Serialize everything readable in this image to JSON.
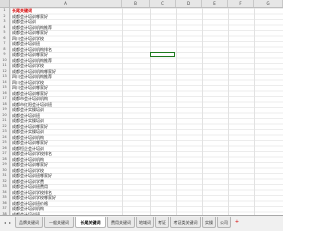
{
  "columns": [
    "A",
    "B",
    "C",
    "D",
    "E",
    "F",
    "G"
  ],
  "rows": [
    "1",
    "2",
    "3",
    "4",
    "5",
    "6",
    "7",
    "8",
    "9",
    "10",
    "11",
    "12",
    "13",
    "14",
    "15",
    "16",
    "17",
    "18",
    "19",
    "20",
    "21",
    "22",
    "23",
    "24",
    "25",
    "26",
    "27",
    "28",
    "29",
    "30",
    "31",
    "32",
    "33",
    "34",
    "35",
    "36",
    "37",
    "38",
    "39",
    "40"
  ],
  "cells": [
    "长尾关键词",
    "成都会计培训哪家好",
    "成都会计培训",
    "成都会计培训机构推荐",
    "成都会计培训哪家好",
    "四川会计培训学校",
    "成都会计培训班",
    "成都会计培训机构排名",
    "成都会计培训哪家好",
    "成都会计培训机构推荐",
    "成都会计培训学校",
    "成都会计培训机构哪家好",
    "四川会计培训机构推荐",
    "四川会计培训学校",
    "四川会计培训哪家好",
    "成都会计培训哪家好",
    "成都市会计培训机构",
    "成都市红阳会计培训班",
    "成都会计实操培训",
    "成都会计培训班",
    "成都会计实操培训",
    "成都会计培训哪家好",
    "成都会计实操培训",
    "成都会计培训机构",
    "成都会计培训哪家好",
    "成都恒企会计培训",
    "成都会计培训学校排名",
    "成都会计培训机构",
    "成都会计培训哪家好",
    "成都会计培训学校",
    "成都会计培训班哪家好",
    "成都会计培训学费",
    "成都会计培训班费用",
    "成都会计培训学校排名",
    "成都会计培训学校哪家好",
    "成都会计培训班价格",
    "成都会计培训机构",
    "成都会计培训班",
    "成都会计培训课程",
    "成都会计培训"
  ],
  "sheet_tabs": [
    "品牌关键词",
    "一般关键词",
    "长尾关键词",
    "费用关键词",
    "地域词",
    "考证",
    "考证类关键词",
    "实操",
    "公司"
  ],
  "active_tab": "长尾关键词",
  "nav": {
    "prev": "◂",
    "next": "▸",
    "add": "+"
  },
  "accent_color": "#d40000"
}
